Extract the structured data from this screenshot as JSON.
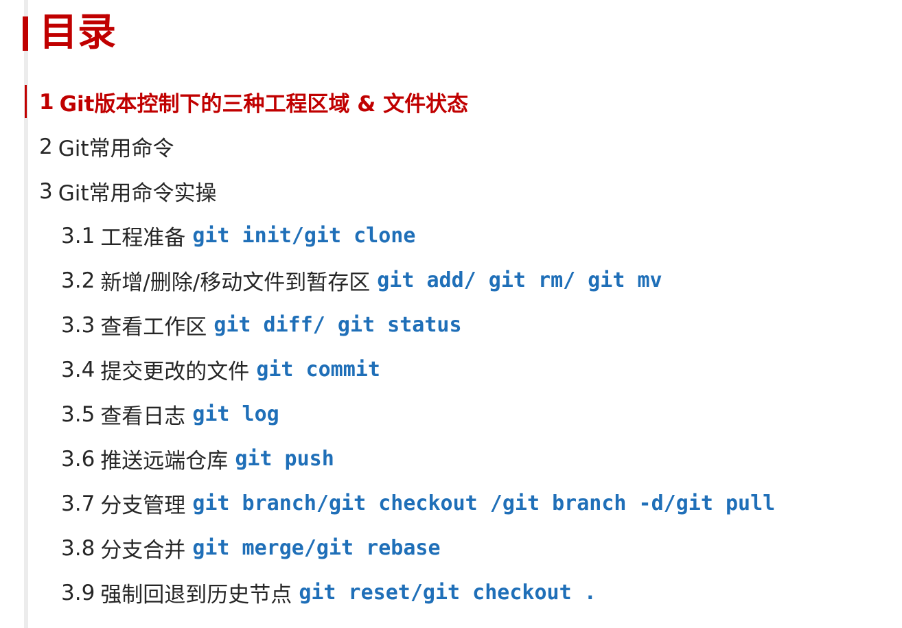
{
  "title": "目录",
  "items": [
    {
      "num": "1",
      "label": "Git版本控制下的三种工程区域 & 文件状态",
      "cmd": ""
    },
    {
      "num": "2",
      "label": "Git常用命令",
      "cmd": ""
    },
    {
      "num": "3",
      "label": "Git常用命令实操",
      "cmd": ""
    },
    {
      "num": "3.1",
      "label": "工程准备",
      "cmd": "git init/git clone"
    },
    {
      "num": "3.2",
      "label": "新增/删除/移动文件到暂存区",
      "cmd": "git add/ git rm/ git mv"
    },
    {
      "num": "3.3",
      "label": "查看工作区",
      "cmd": "git diff/ git status"
    },
    {
      "num": "3.4",
      "label": "提交更改的文件",
      "cmd": "git commit"
    },
    {
      "num": "3.5",
      "label": "查看日志",
      "cmd": "git log"
    },
    {
      "num": "3.6",
      "label": "推送远端仓库",
      "cmd": "git push"
    },
    {
      "num": "3.7",
      "label": "分支管理",
      "cmd": "git branch/git checkout /git branch -d/git pull"
    },
    {
      "num": "3.8",
      "label": "分支合并",
      "cmd": "git merge/git rebase"
    },
    {
      "num": "3.9",
      "label": "强制回退到历史节点",
      "cmd": "git reset/git checkout ."
    }
  ],
  "colors": {
    "accent": "#c00000",
    "command": "#1f6fb8",
    "text": "#262626"
  }
}
